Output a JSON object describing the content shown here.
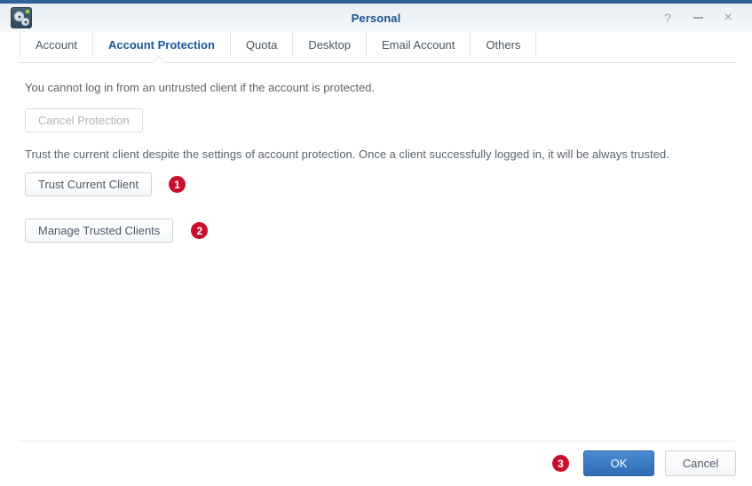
{
  "window": {
    "title": "Personal",
    "app_icon": "settings-gears-icon",
    "controls": {
      "help": "?",
      "minimize": "–",
      "close": "×"
    }
  },
  "tabs": [
    {
      "label": "Account",
      "active": false
    },
    {
      "label": "Account Protection",
      "active": true
    },
    {
      "label": "Quota",
      "active": false
    },
    {
      "label": "Desktop",
      "active": false
    },
    {
      "label": "Email Account",
      "active": false
    },
    {
      "label": "Others",
      "active": false
    }
  ],
  "main": {
    "protection_description": "You cannot log in from an untrusted client if the account is protected.",
    "cancel_protection_label": "Cancel Protection",
    "trust_description": "Trust the current client despite the settings of account protection. Once a client successfully logged in, it will be always trusted.",
    "trust_current_client_label": "Trust Current Client",
    "manage_trusted_clients_label": "Manage Trusted Clients",
    "badges": {
      "trust_current_client": "1",
      "manage_trusted_clients": "2",
      "ok": "3"
    }
  },
  "footer": {
    "ok_label": "OK",
    "cancel_label": "Cancel"
  },
  "colors": {
    "title_accent": "#2e6196",
    "title_text": "#20538d",
    "active_tab": "#1b5596",
    "badge_red": "#c8102e",
    "primary_button": "#3b7ec6"
  }
}
